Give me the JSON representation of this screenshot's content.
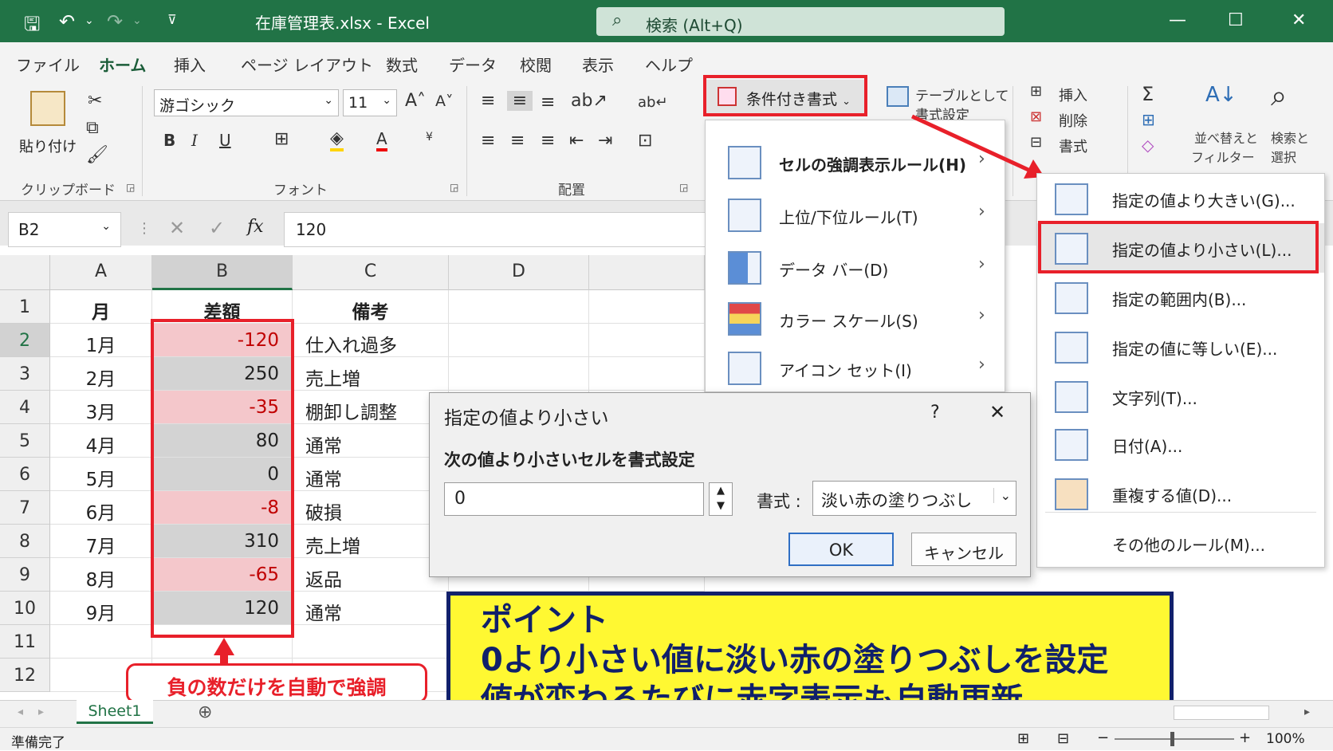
{
  "title": {
    "filename": "在庫管理表.xlsx",
    "sep": "-",
    "app": "Excel",
    "search": "検索 (Alt+Q)"
  },
  "menu": [
    "ファイル",
    "ホーム",
    "挿入",
    "ページ レイアウト",
    "数式",
    "データ",
    "校閲",
    "表示",
    "ヘルプ"
  ],
  "ribbon": {
    "paste": "貼り付け",
    "clipboard": "クリップボード",
    "font_name": "游ゴシック",
    "font_size": "11",
    "font_group": "フォント",
    "align_group": "配置",
    "cond_format": "条件付き書式",
    "table_format_1": "テーブルとして",
    "table_format_2": "書式設定",
    "insert": "挿入",
    "delete": "削除",
    "format": "書式",
    "sort_1": "並べ替えと",
    "sort_2": "フィルター",
    "find_1": "検索と",
    "find_2": "選択"
  },
  "formula_bar": {
    "name_box": "B2",
    "fx": "fx",
    "value": "120"
  },
  "columns": [
    "A",
    "B",
    "C",
    "D"
  ],
  "rows": [
    {
      "n": "1",
      "a": "月",
      "b": "差額",
      "c": "備考",
      "type": "header"
    },
    {
      "n": "2",
      "a": "1月",
      "b": "-120",
      "c": "仕入れ過多",
      "type": "neg"
    },
    {
      "n": "3",
      "a": "2月",
      "b": "250",
      "c": "売上増",
      "type": "pos"
    },
    {
      "n": "4",
      "a": "3月",
      "b": "-35",
      "c": "棚卸し調整",
      "type": "neg"
    },
    {
      "n": "5",
      "a": "4月",
      "b": "80",
      "c": "通常",
      "type": "pos"
    },
    {
      "n": "6",
      "a": "5月",
      "b": "0",
      "c": "通常",
      "type": "pos"
    },
    {
      "n": "7",
      "a": "6月",
      "b": "-8",
      "c": "破損",
      "type": "neg"
    },
    {
      "n": "8",
      "a": "7月",
      "b": "310",
      "c": "売上増",
      "type": "pos"
    },
    {
      "n": "9",
      "a": "8月",
      "b": "-65",
      "c": "返品",
      "type": "neg"
    },
    {
      "n": "10",
      "a": "9月",
      "b": "120",
      "c": "通常",
      "type": "pos"
    },
    {
      "n": "11",
      "a": "",
      "b": "",
      "c": "",
      "type": "empty"
    },
    {
      "n": "12",
      "a": "",
      "b": "",
      "c": "",
      "type": "empty"
    }
  ],
  "cf_menu": [
    "セルの強調表示ルール(H)",
    "上位/下位ルール(T)",
    "データ バー(D)",
    "カラー スケール(S)",
    "アイコン セット(I)"
  ],
  "submenu": [
    "指定の値より大きい(G)...",
    "指定の値より小さい(L)...",
    "指定の範囲内(B)...",
    "指定の値に等しい(E)...",
    "文字列(T)...",
    "日付(A)...",
    "重複する値(D)...",
    "その他のルール(M)..."
  ],
  "dialog": {
    "title": "指定の値より小さい",
    "help": "?",
    "close": "✕",
    "instruction": "次の値より小さいセルを書式設定",
    "value": "0",
    "format_label": "書式 :",
    "format_value": "淡い赤の塗りつぶし",
    "ok": "OK",
    "cancel": "キャンセル"
  },
  "callout": "負の数だけを自動で強調",
  "point": {
    "line1": "ポイント",
    "line2": "0より小さい値に淡い赤の塗りつぶしを設定",
    "line3": "値が変わるたびに赤字表示も自動更新"
  },
  "sheet_tab": "Sheet1",
  "status": {
    "ready": "準備完了",
    "zoom": "100%"
  },
  "colors": {
    "excel_green": "#217346",
    "highlight_red": "#e8202a",
    "neg_fill": "#f4c7cb",
    "neg_text": "#c00000",
    "point_fill": "#fff832",
    "point_border": "#12216b"
  }
}
